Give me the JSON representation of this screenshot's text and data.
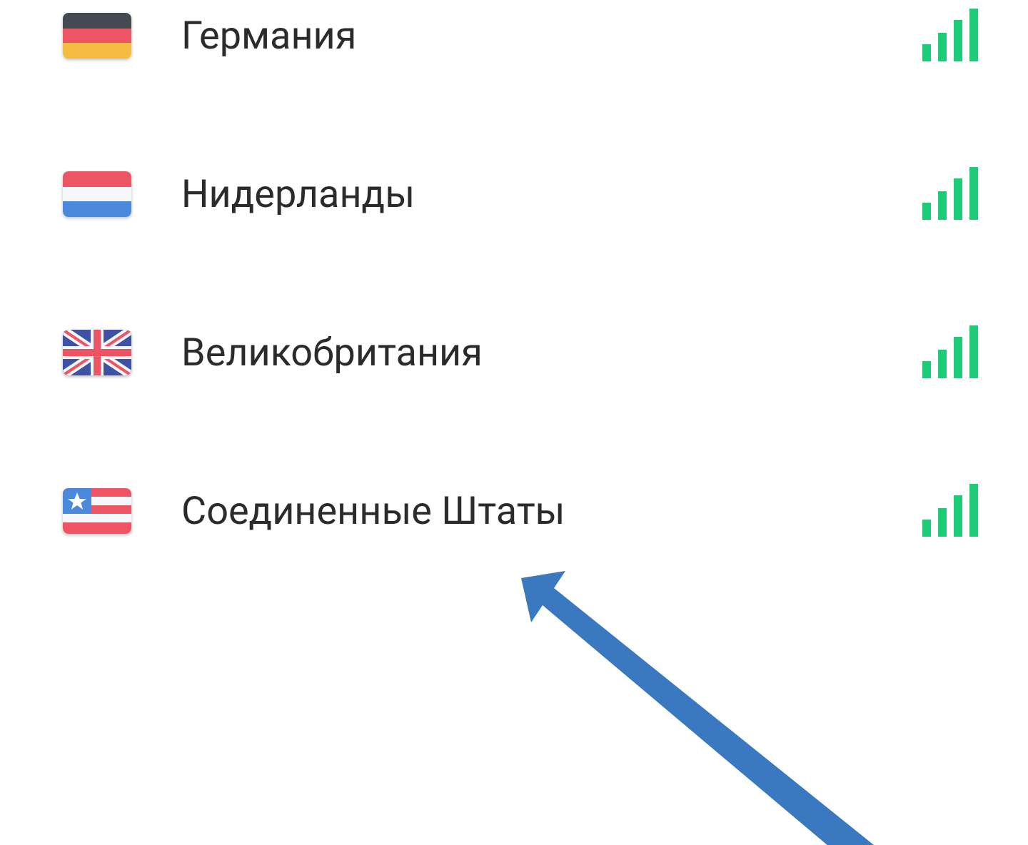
{
  "countries": [
    {
      "name": "Германия",
      "kind": "de"
    },
    {
      "name": "Нидерланды",
      "kind": "nl"
    },
    {
      "name": "Великобритания",
      "kind": "gb"
    },
    {
      "name": "Соединенные Штаты",
      "kind": "us"
    }
  ]
}
